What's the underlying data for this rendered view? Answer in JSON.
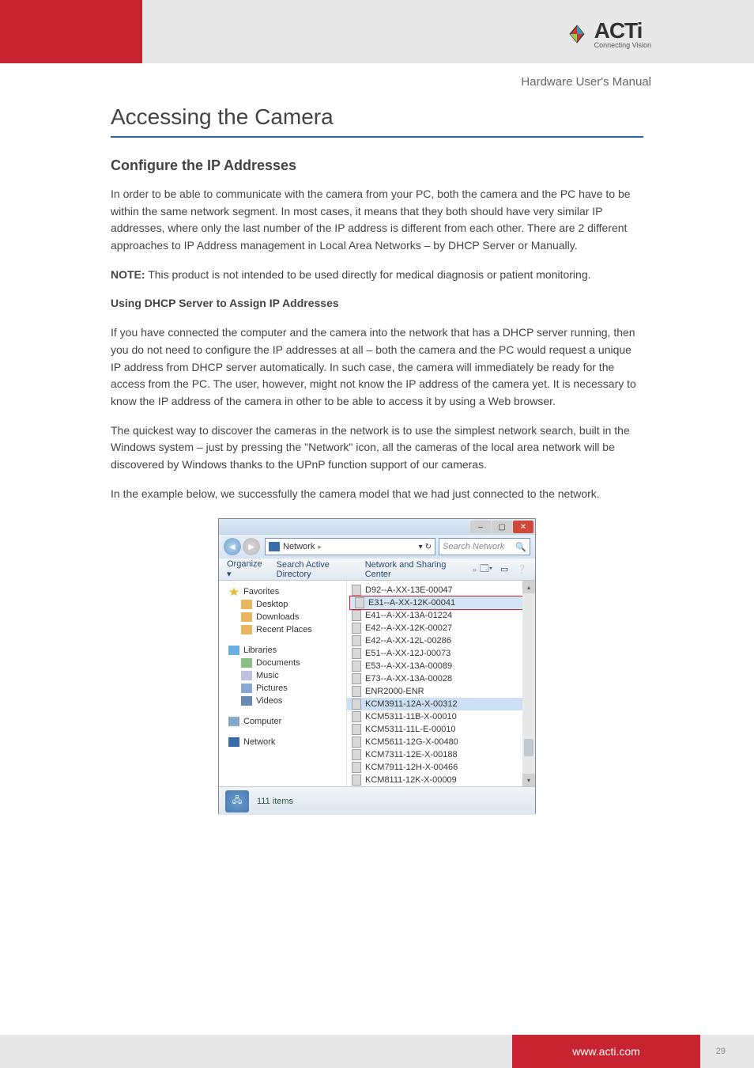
{
  "brand": {
    "name": "ACTi",
    "tagline": "Connecting Vision"
  },
  "doc_title": "Hardware User's Manual",
  "h1": "Accessing the Camera",
  "h2": "Configure the IP Addresses",
  "paragraphs": {
    "intro": "In order to be able to communicate with the camera from your PC, both the camera and the PC have to be within the same network segment. In most cases, it means that they both should have very similar IP addresses, where only the last number of the IP address is different from each other. There are 2 different approaches to IP Address management in Local Area Networks – by DHCP Server or Manually.",
    "dhcp_title": "Using DHCP Server to Assign IP Addresses",
    "dhcp_body": "If you have connected the computer and the camera into the network that has a DHCP server running, then you do not need to configure the IP addresses at all – both the camera and the PC would request a unique IP address from DHCP server automatically. In such case, the camera will immediately be ready for the access from the PC. The user, however, might not know the IP address of the camera yet. It is necessary to know the IP address of the camera in other to be able to access it by using a Web browser.",
    "upnp": "The quickest way to discover the cameras in the network is to use the simplest network search, built in the Windows system – just by pressing the \"Network\" icon, all the cameras of the local area network will be discovered by Windows thanks to the UPnP function support of our cameras.",
    "example": "In the example below, we successfully the camera model that we had just connected to the network."
  },
  "note_label": "NOTE:",
  "note_text": " This product is not intended to be used directly for medical diagnosis or patient monitoring.",
  "explorer": {
    "address_label": "Network",
    "search_placeholder": "Search Network",
    "toolbar": {
      "organize": "Organize ▾",
      "search_ad": "Search Active Directory",
      "sharing": "Network and Sharing Center"
    },
    "sidebar": {
      "favorites": "Favorites",
      "desktop": "Desktop",
      "downloads": "Downloads",
      "recent": "Recent Places",
      "libraries": "Libraries",
      "documents": "Documents",
      "music": "Music",
      "pictures": "Pictures",
      "videos": "Videos",
      "computer": "Computer",
      "network": "Network"
    },
    "files": [
      "D92--A-XX-13E-00047",
      "E31--A-XX-12K-00041",
      "E41--A-XX-13A-01224",
      "E42--A-XX-12K-00027",
      "E42--A-XX-12L-00286",
      "E51--A-XX-12J-00073",
      "E53--A-XX-13A-00089",
      "E73--A-XX-13A-00028",
      "ENR2000-ENR",
      "KCM3911-12A-X-00312",
      "KCM5311-11B-X-00010",
      "KCM5311-11L-E-00010",
      "KCM5611-12G-X-00480",
      "KCM7311-12E-X-00188",
      "KCM7911-12H-X-00466",
      "KCM8111-12K-X-00009"
    ],
    "highlighted_index": 1,
    "selected_index": 9,
    "status": "111 items"
  },
  "footer": {
    "url": "www.acti.com",
    "page": "29"
  }
}
